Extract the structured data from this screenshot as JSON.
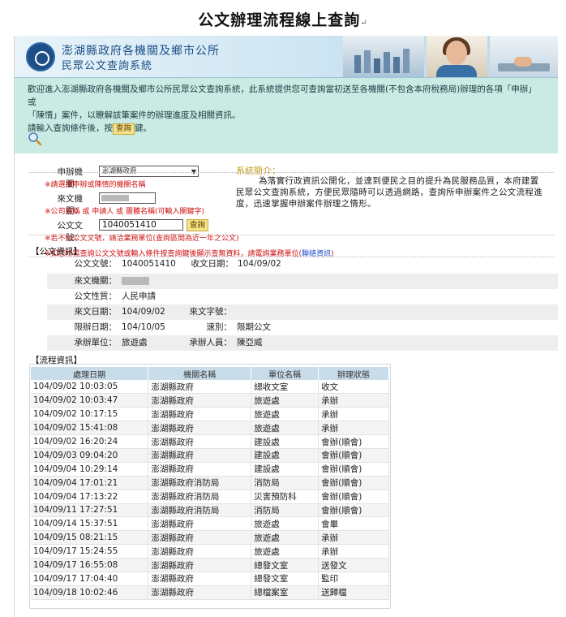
{
  "doc_title": "公文辦理流程線上查詢",
  "banner": {
    "title_line1": "澎湖縣政府各機關及鄉市公所",
    "title_line2": "民眾公文查詢系統"
  },
  "intro": {
    "line1": "歡迎進入澎湖縣政府各機關及鄉市公所民眾公文查詢系統，此系統提供您可查詢當初送至各機關(不包含本府稅務局)辦理的各項「申辦」或",
    "line2": "「陳情」案件，以瞭解該筆案件的辦理進度及相關資訊。",
    "line3_prefix": "請輸入查詢條件後，按",
    "line3_chip": "查詢",
    "line3_suffix": "鍵。"
  },
  "form": {
    "agency_label": "申辦機關：",
    "agency_selected": "澎湖縣政府",
    "agency_hint": "※請選擇申辦或陳情的機關名稱",
    "sender_label": "來文機關：",
    "sender_hint": "※公司名稱 或 申請人 或 團體名稱(可輸入關鍵字)",
    "docno_label": "公文文號：",
    "docno_value": "1040051410",
    "query_button": "查詢",
    "docno_hint": "※若不知公文文號，請洽業務單位(查詢區間為近一年之公文)",
    "note_prefix": "※如您所需查詢公文文號或輸入條件按查詢鍵後顯示查無資料，請電詢業務單位(",
    "note_link": "聯絡資訊",
    "note_suffix": ")"
  },
  "system_intro": {
    "title": "系統簡介：",
    "text": "為落實行政資訊公開化，並達到便民之目的提升為民服務品質，本府建置民眾公文查詢系統，方便民眾隨時可以透過網路，查詢所申辦案件之公文流程進度，迅速掌握申辦案件辦理之情形。"
  },
  "doc_info": {
    "section_title": "【公文資訊】",
    "doc_no_label": "公文文號：",
    "doc_no": "1040051410",
    "recv_date_label": "收文日期：",
    "recv_date": "104/09/02",
    "sender_label": "來文機關：",
    "nature_label": "公文性質：",
    "nature": "人民申請",
    "sent_date_label": "來文日期：",
    "sent_date": "104/09/02",
    "sent_no_label": "來文字號：",
    "sent_no": "",
    "deadline_label": "限辦日期：",
    "deadline": "104/10/05",
    "speed_label": "速別：",
    "speed": "限期公文",
    "unit_label": "承辦單位：",
    "unit": "旅遊處",
    "handler_label": "承辦人員：",
    "handler": "陳亞威"
  },
  "flow": {
    "section_title": "【流程資訊】",
    "headers": [
      "處理日期",
      "機關名稱",
      "單位名稱",
      "辦理狀態"
    ],
    "rows": [
      [
        "104/09/02 10:03:05",
        "澎湖縣政府",
        "總收文室",
        "收文"
      ],
      [
        "104/09/02 10:03:47",
        "澎湖縣政府",
        "旅遊處",
        "承辦"
      ],
      [
        "104/09/02 10:17:15",
        "澎湖縣政府",
        "旅遊處",
        "承辦"
      ],
      [
        "104/09/02 15:41:08",
        "澎湖縣政府",
        "旅遊處",
        "承辦"
      ],
      [
        "104/09/02 16:20:24",
        "澎湖縣政府",
        "建設處",
        "會辦(順會)"
      ],
      [
        "104/09/03 09:04:20",
        "澎湖縣政府",
        "建設處",
        "會辦(順會)"
      ],
      [
        "104/09/04 10:29:14",
        "澎湖縣政府",
        "建設處",
        "會辦(順會)"
      ],
      [
        "104/09/04 17:01:21",
        "澎湖縣政府消防局",
        "消防局",
        "會辦(順會)"
      ],
      [
        "104/09/04 17:13:22",
        "澎湖縣政府消防局",
        "災害預防科",
        "會辦(順會)"
      ],
      [
        "104/09/11 17:27:51",
        "澎湖縣政府消防局",
        "消防局",
        "會辦(順會)"
      ],
      [
        "104/09/14 15:37:51",
        "澎湖縣政府",
        "旅遊處",
        "會畢"
      ],
      [
        "104/09/15 08:21:15",
        "澎湖縣政府",
        "旅遊處",
        "承辦"
      ],
      [
        "104/09/17 15:24:55",
        "澎湖縣政府",
        "旅遊處",
        "承辦"
      ],
      [
        "104/09/17 16:55:08",
        "澎湖縣政府",
        "總發文室",
        "送發文"
      ],
      [
        "104/09/17 17:04:40",
        "澎湖縣政府",
        "總發文室",
        "監印"
      ],
      [
        "104/09/18 10:02:46",
        "澎湖縣政府",
        "總檔案室",
        "送歸檔"
      ]
    ]
  }
}
